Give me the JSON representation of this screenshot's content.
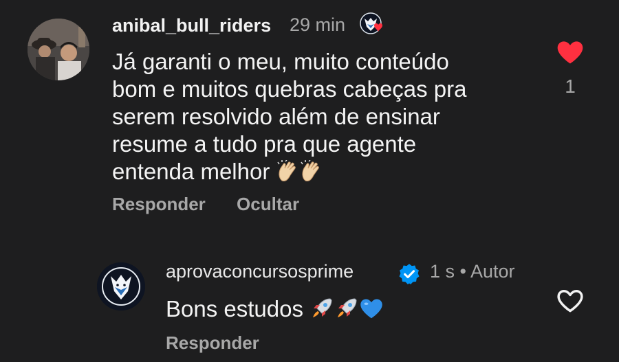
{
  "comments": [
    {
      "username": "anibal_bull_riders",
      "time": "29 min",
      "lines": [
        "Já garanti o meu, muito conteúdo",
        "bom e muitos quebras cabeças pra",
        "serem resolvido além de ensinar",
        "resume a tudo pra que agente",
        "entenda melhor"
      ],
      "actions": [
        "Responder",
        "Ocultar"
      ],
      "liked": true,
      "like_count": "1"
    },
    {
      "username": "aprovaconcursosprime",
      "meta": "1 s • Autor",
      "text": "Bons estudos",
      "actions": [
        "Responder"
      ],
      "liked": false
    }
  ],
  "icons": {
    "heart_filled": "heart-filled-icon",
    "heart_outline": "heart-outline-icon",
    "verified": "verified-badge-icon",
    "clap": "clapping-hands-emoji",
    "rocket": "rocket-emoji",
    "blue_heart": "blue-heart-emoji"
  },
  "colors": {
    "background": "#1e1e1f",
    "like_red": "#ff3040",
    "verified_blue": "#0095f6",
    "muted_text": "#a8a8a8"
  }
}
